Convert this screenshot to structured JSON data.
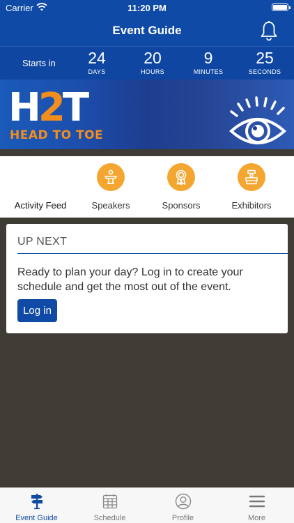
{
  "status_bar": {
    "carrier": "Carrier",
    "time": "11:20 PM"
  },
  "nav": {
    "title": "Event Guide",
    "bell_icon": "bell-icon"
  },
  "countdown": {
    "label": "Starts in",
    "units": [
      {
        "value": "24",
        "label": "DAYS"
      },
      {
        "value": "20",
        "label": "HOURS"
      },
      {
        "value": "9",
        "label": "MINUTES"
      },
      {
        "value": "25",
        "label": "SECONDS"
      }
    ]
  },
  "banner": {
    "logo_left": "H",
    "logo_mid": "2",
    "logo_right": "T",
    "tagline": "HEAD TO TOE",
    "icon": "eye-icon"
  },
  "tabs": [
    {
      "label": "Activity Feed"
    },
    {
      "label": "Speakers",
      "icon": "speaker-podium-icon"
    },
    {
      "label": "Sponsors",
      "icon": "award-ribbon-icon"
    },
    {
      "label": "Exhibitors",
      "icon": "exhibitor-booth-icon"
    }
  ],
  "up_next": {
    "heading": "UP NEXT",
    "message": "Ready to plan your day? Log in to create your schedule and get the most out of the event.",
    "login_label": "Log in"
  },
  "tab_bar": [
    {
      "label": "Event Guide",
      "icon": "signpost-icon",
      "active": true
    },
    {
      "label": "Schedule",
      "icon": "calendar-icon",
      "active": false
    },
    {
      "label": "Profile",
      "icon": "profile-icon",
      "active": false
    },
    {
      "label": "More",
      "icon": "menu-icon",
      "active": false
    }
  ],
  "colors": {
    "brand_blue": "#0f4aa6",
    "accent_orange": "#f5a631",
    "background_dark": "#3f3b35"
  }
}
